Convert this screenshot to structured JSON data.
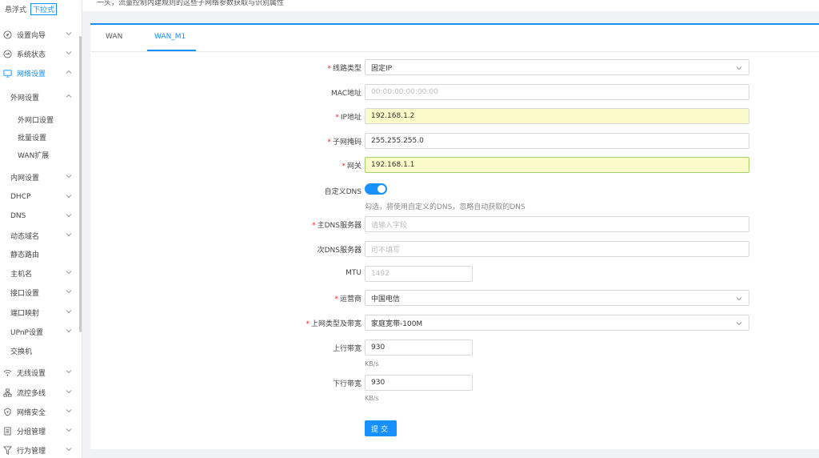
{
  "top_notice": "一头，流量控制内建规则的这些子网络参数获取与识别属性",
  "sidebar": {
    "mode_float": "悬浮式",
    "mode_dropdown": "下拉式",
    "items": [
      {
        "label": "设置向导",
        "icon": "compass-icon"
      },
      {
        "label": "系统状态",
        "icon": "dashboard-icon"
      },
      {
        "label": "网络设置",
        "icon": "monitor-icon"
      },
      {
        "label": "外网设置"
      },
      {
        "label": "外网口设置"
      },
      {
        "label": "批量设置"
      },
      {
        "label": "WAN扩展"
      },
      {
        "label": "内网设置"
      },
      {
        "label": "DHCP"
      },
      {
        "label": "DNS"
      },
      {
        "label": "动态域名"
      },
      {
        "label": "静态路由"
      },
      {
        "label": "主机名"
      },
      {
        "label": "接口设置"
      },
      {
        "label": "端口映射"
      },
      {
        "label": "UPnP设置"
      },
      {
        "label": "交换机"
      },
      {
        "label": "无线设置",
        "icon": "wifi-icon"
      },
      {
        "label": "流控多线",
        "icon": "network-icon"
      },
      {
        "label": "网络安全",
        "icon": "shield-icon"
      },
      {
        "label": "分组管理",
        "icon": "document-icon"
      },
      {
        "label": "行为管理",
        "icon": "filter-icon"
      }
    ]
  },
  "tabs": [
    "WAN",
    "WAN_M1"
  ],
  "form": {
    "line_type": {
      "label": "线路类型",
      "value": "固定IP"
    },
    "mac": {
      "label": "MAC地址",
      "placeholder": "00:00:00:00:00:00"
    },
    "ip": {
      "label": "IP地址",
      "value": "192.168.1.2"
    },
    "netmask": {
      "label": "子网掩码",
      "value": "255.255.255.0"
    },
    "gateway": {
      "label": "网关",
      "value": "192.168.1.1"
    },
    "custom_dns": {
      "label": "自定义DNS",
      "hint": "勾选，将使用自定义的DNS，忽略自动获取的DNS"
    },
    "primary_dns": {
      "label": "主DNS服务器",
      "placeholder": "请输入字段"
    },
    "secondary_dns": {
      "label": "次DNS服务器",
      "placeholder": "可不填写"
    },
    "mtu": {
      "label": "MTU",
      "placeholder": "1492"
    },
    "isp": {
      "label": "运营商",
      "value": "中国电信"
    },
    "access_type": {
      "label": "上网类型及带宽",
      "value": "家庭宽带-100M"
    },
    "upload": {
      "label": "上行带宽",
      "value": "930",
      "unit": "KB/s"
    },
    "download": {
      "label": "下行带宽",
      "value": "930",
      "unit": "KB/s"
    },
    "submit_label": "提交"
  },
  "colors": {
    "accent": "#1890ff",
    "required": "#f5222d",
    "highlight": "#fbfbc9"
  }
}
